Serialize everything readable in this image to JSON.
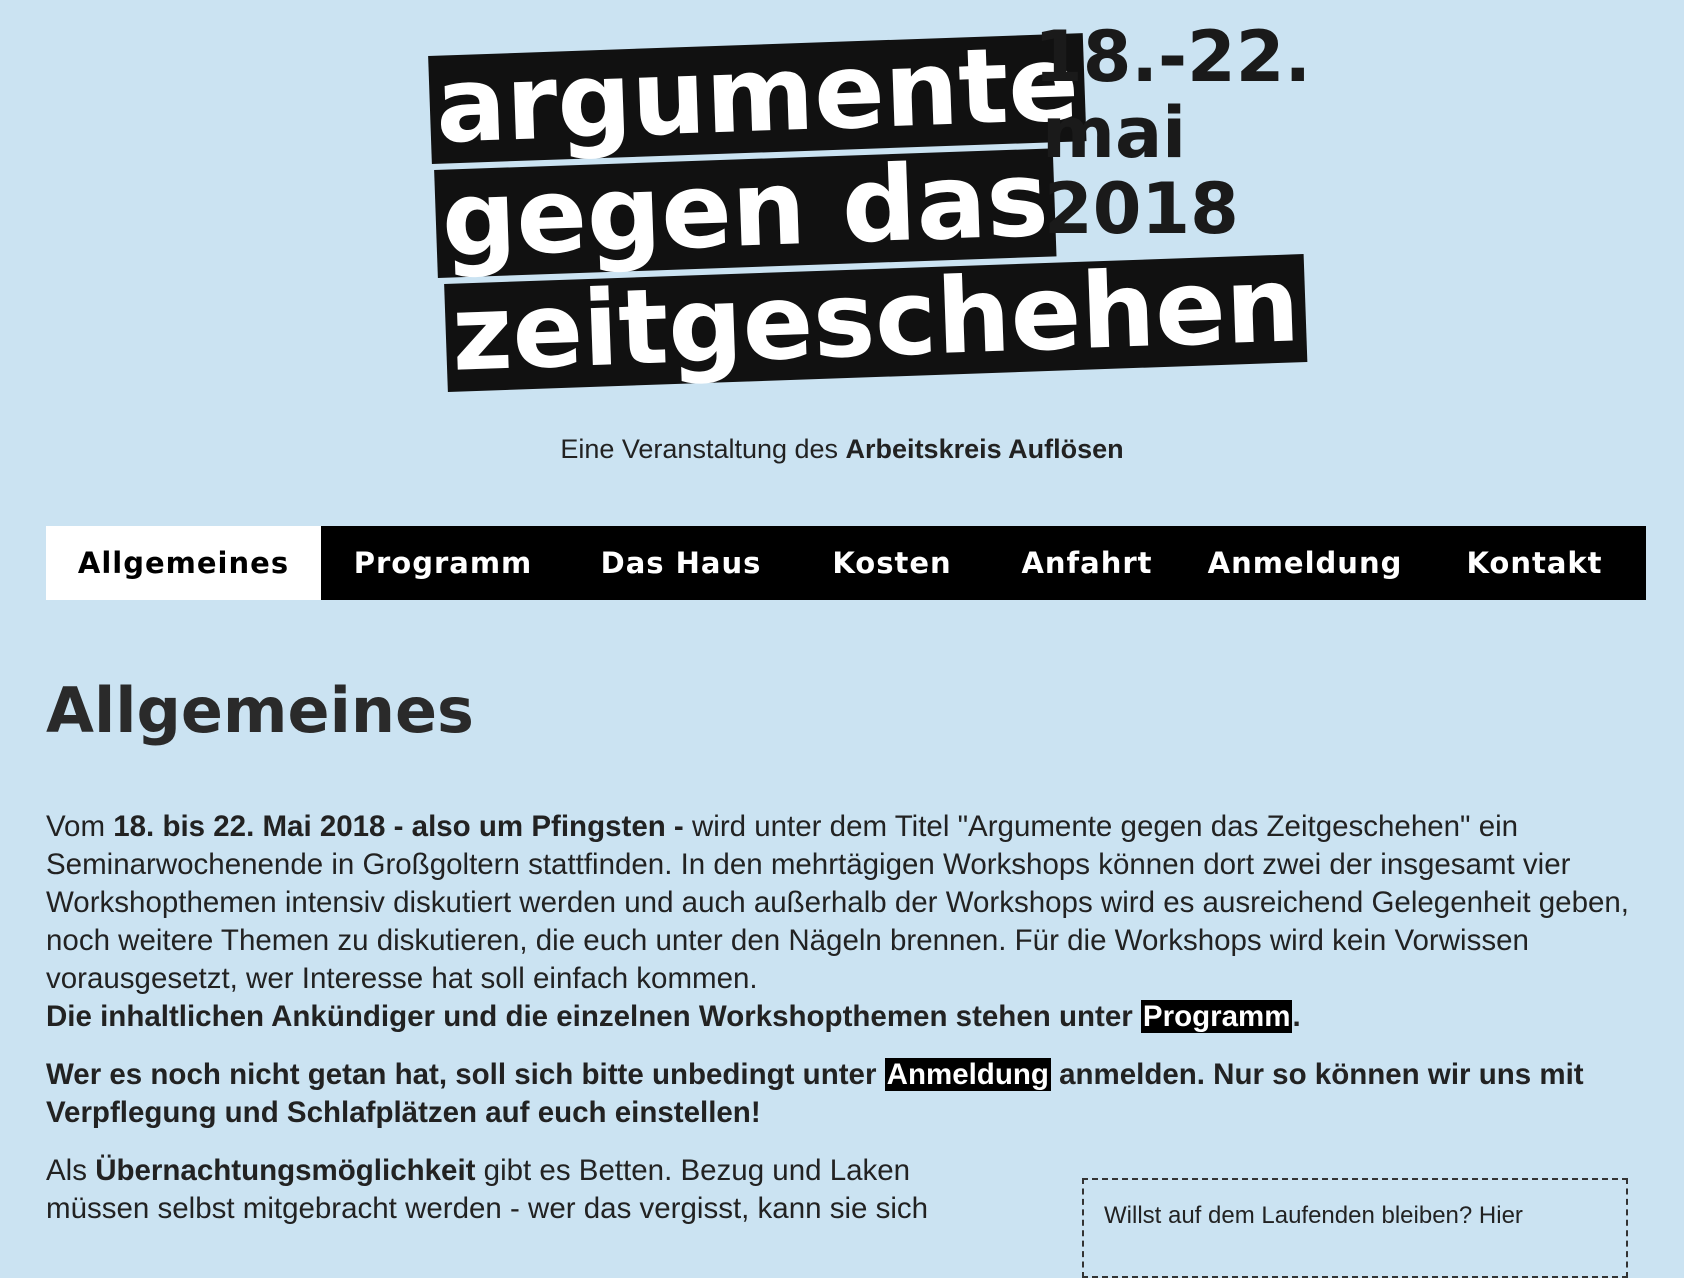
{
  "logo": {
    "line1": "argumente",
    "line2": "gegen das",
    "line3": "zeitgeschehen",
    "date1": "18.-22.",
    "date2": "mai",
    "date3": "2018"
  },
  "subtitle": {
    "prefix": "Eine Veranstaltung des ",
    "org": "Arbeitskreis Auflösen"
  },
  "nav": {
    "items": [
      {
        "label": "Allgemeines"
      },
      {
        "label": "Programm"
      },
      {
        "label": "Das Haus"
      },
      {
        "label": "Kosten"
      },
      {
        "label": "Anfahrt"
      },
      {
        "label": "Anmeldung"
      },
      {
        "label": "Kontakt"
      }
    ],
    "active": "Allgemeines"
  },
  "main": {
    "heading": "Allgemeines",
    "p1": {
      "t1": "Vom ",
      "b1": "18. bis 22. Mai 2018 - also um Pfingsten -",
      "t2": " wird unter dem Titel \"Argumente gegen das Zeitgeschehen\" ein Seminarwochenende in Großgoltern stattfinden. In den mehrtägigen Workshops können dort zwei der insgesamt vier Workshopthemen intensiv diskutiert werden und auch außerhalb der Workshops wird es ausreichend Gelegenheit geben, noch weitere Themen zu diskutieren, die euch unter den Nägeln brennen. Für die Workshops wird kein Vorwissen vorausgesetzt, wer Interesse hat soll einfach kommen.",
      "b2": "Die inhaltlichen Ankündiger und die einzelnen Workshopthemen stehen unter ",
      "link": "Programm",
      "b3": "."
    },
    "p2": {
      "b1": "Wer es noch nicht getan hat, soll sich bitte unbedingt unter ",
      "link": "Anmeldung",
      "b2": " anmelden. Nur so können wir uns mit Verpflegung und Schlafplätzen auf euch einstellen!"
    },
    "p3": {
      "t1": "Als ",
      "b1": "Übernachtungsmöglichkeit",
      "t2": " gibt es Betten. Bezug und Laken müssen selbst mitgebracht werden - wer das vergisst, kann sie sich"
    },
    "box": {
      "text": "Willst auf dem Laufenden bleiben? Hier"
    }
  }
}
